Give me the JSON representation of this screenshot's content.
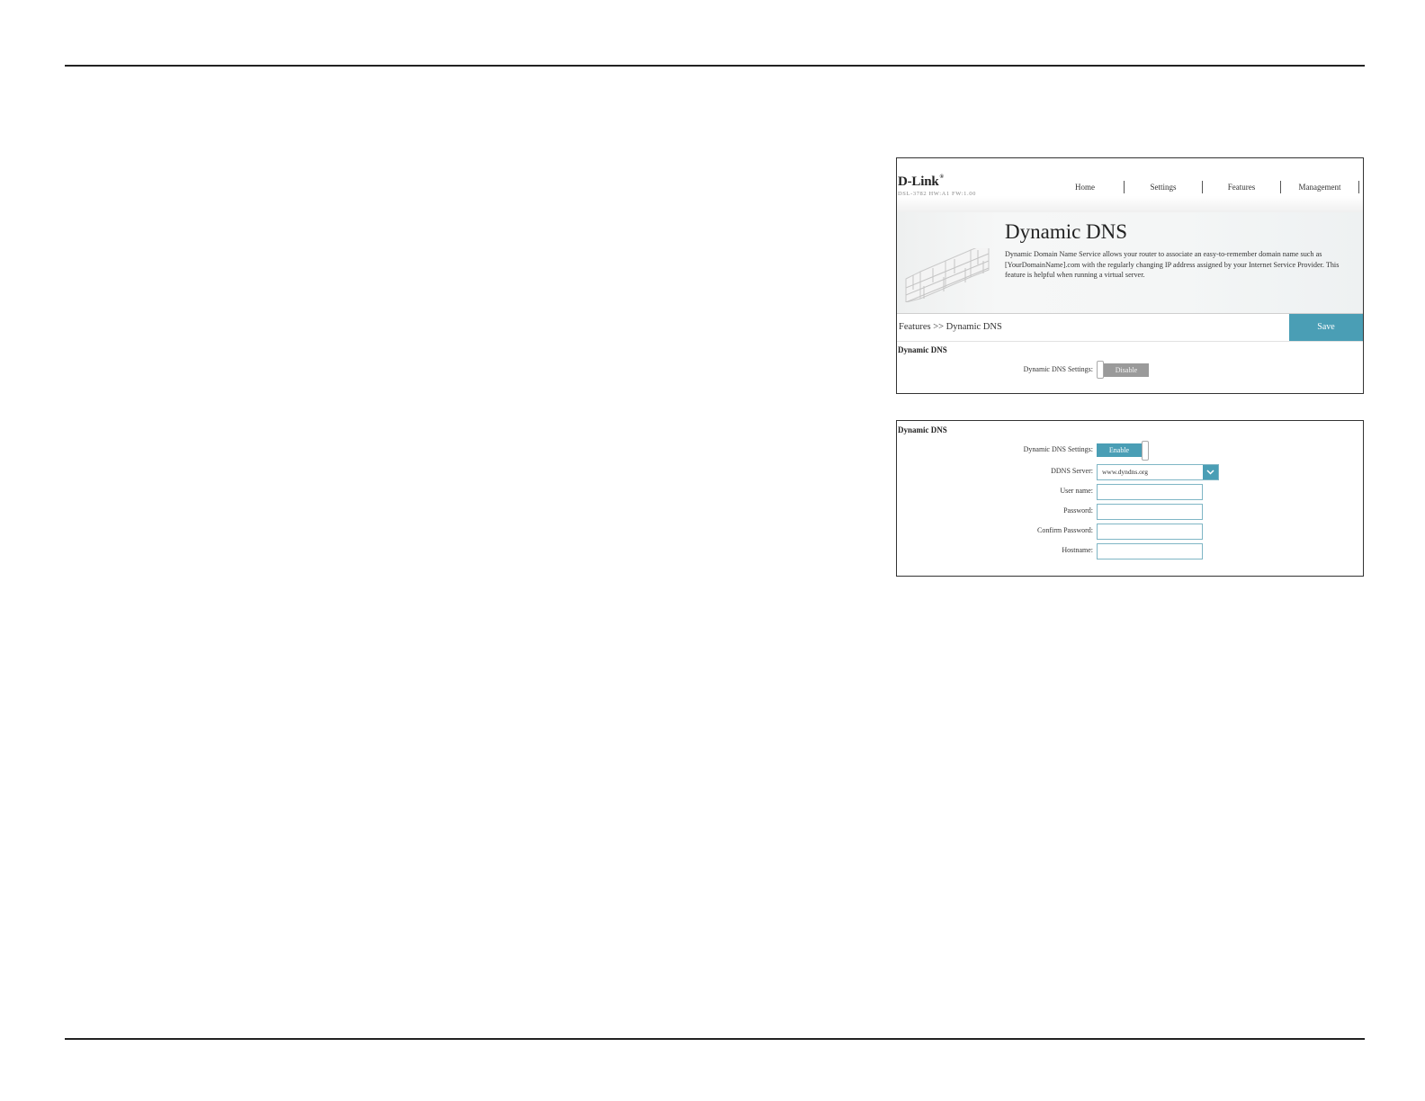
{
  "screenshot_top": {
    "logo": "D-Link",
    "logo_mark": "®",
    "model_info": "DSL-3782  HW:A1  FW:1.00",
    "nav": [
      "Home",
      "Settings",
      "Features",
      "Management"
    ],
    "banner_title": "Dynamic DNS",
    "banner_description": "Dynamic Domain Name Service allows your router to associate an easy-to-remember domain name such as [YourDomainName].com with the regularly changing IP address assigned by your Internet Service Provider. This feature is helpful when running a virtual server.",
    "breadcrumb": "Features >> Dynamic DNS",
    "save_label": "Save",
    "section_title": "Dynamic DNS",
    "ddns_settings_label": "Dynamic DNS Settings:",
    "toggle_label": "Disable"
  },
  "screenshot_bottom": {
    "section_title": "Dynamic DNS",
    "ddns_settings_label": "Dynamic DNS Settings:",
    "toggle_label": "Enable",
    "server_label": "DDNS Server:",
    "server_value": "www.dyndns.org",
    "username_label": "User name:",
    "username_value": "",
    "password_label": "Password:",
    "password_value": "",
    "confirm_password_label": "Confirm Password:",
    "confirm_password_value": "",
    "hostname_label": "Hostname:",
    "hostname_value": ""
  },
  "colors": {
    "accent": "#4a9eb5",
    "toggle_off": "#9a9a9a"
  }
}
